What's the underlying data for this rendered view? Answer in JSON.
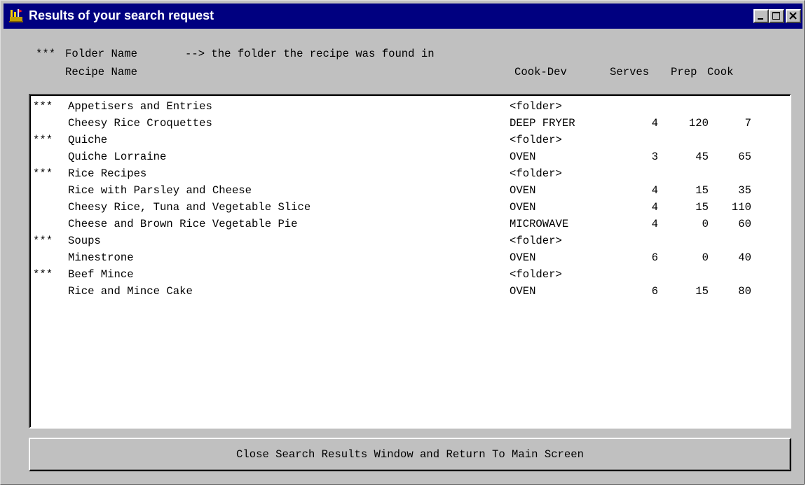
{
  "window": {
    "title": "Results of your search request"
  },
  "header": {
    "line1_marker": "***",
    "line1_label": "Folder Name",
    "line1_note": "--> the folder the recipe was found in",
    "recipe_name": "Recipe Name",
    "cook_dev": "Cook-Dev",
    "serves": "Serves",
    "prep": "Prep",
    "cook": "Cook"
  },
  "results": [
    {
      "marker": "***",
      "name": "Appetisers and Entries",
      "device": "<folder>",
      "serves": "",
      "prep": "",
      "cook": ""
    },
    {
      "marker": "",
      "name": "Cheesy Rice Croquettes",
      "device": "DEEP FRYER",
      "serves": "4",
      "prep": "120",
      "cook": "7"
    },
    {
      "marker": "***",
      "name": "Quiche",
      "device": "<folder>",
      "serves": "",
      "prep": "",
      "cook": ""
    },
    {
      "marker": "",
      "name": "Quiche Lorraine",
      "device": "OVEN",
      "serves": "3",
      "prep": "45",
      "cook": "65"
    },
    {
      "marker": "***",
      "name": "Rice Recipes",
      "device": "<folder>",
      "serves": "",
      "prep": "",
      "cook": ""
    },
    {
      "marker": "",
      "name": "Rice with Parsley and Cheese",
      "device": "OVEN",
      "serves": "4",
      "prep": "15",
      "cook": "35"
    },
    {
      "marker": "",
      "name": "Cheesy Rice, Tuna and Vegetable Slice",
      "device": "OVEN",
      "serves": "4",
      "prep": "15",
      "cook": "110"
    },
    {
      "marker": "",
      "name": "Cheese and Brown Rice Vegetable Pie",
      "device": "MICROWAVE",
      "serves": "4",
      "prep": "0",
      "cook": "60"
    },
    {
      "marker": "***",
      "name": "Soups",
      "device": "<folder>",
      "serves": "",
      "prep": "",
      "cook": ""
    },
    {
      "marker": "",
      "name": "Minestrone",
      "device": "OVEN",
      "serves": "6",
      "prep": "0",
      "cook": "40"
    },
    {
      "marker": "***",
      "name": "Beef Mince",
      "device": "<folder>",
      "serves": "",
      "prep": "",
      "cook": ""
    },
    {
      "marker": "",
      "name": "Rice and Mince Cake",
      "device": "OVEN",
      "serves": "6",
      "prep": "15",
      "cook": "80"
    }
  ],
  "close_button": {
    "label": "Close Search Results Window and Return To Main Screen"
  },
  "icons": {
    "app": "app-icon",
    "minimize": "minimize-icon",
    "maximize": "maximize-icon",
    "close": "close-icon"
  },
  "colors": {
    "titlebar": "#000080",
    "face": "#c0c0c0",
    "list_bg": "#ffffff"
  }
}
